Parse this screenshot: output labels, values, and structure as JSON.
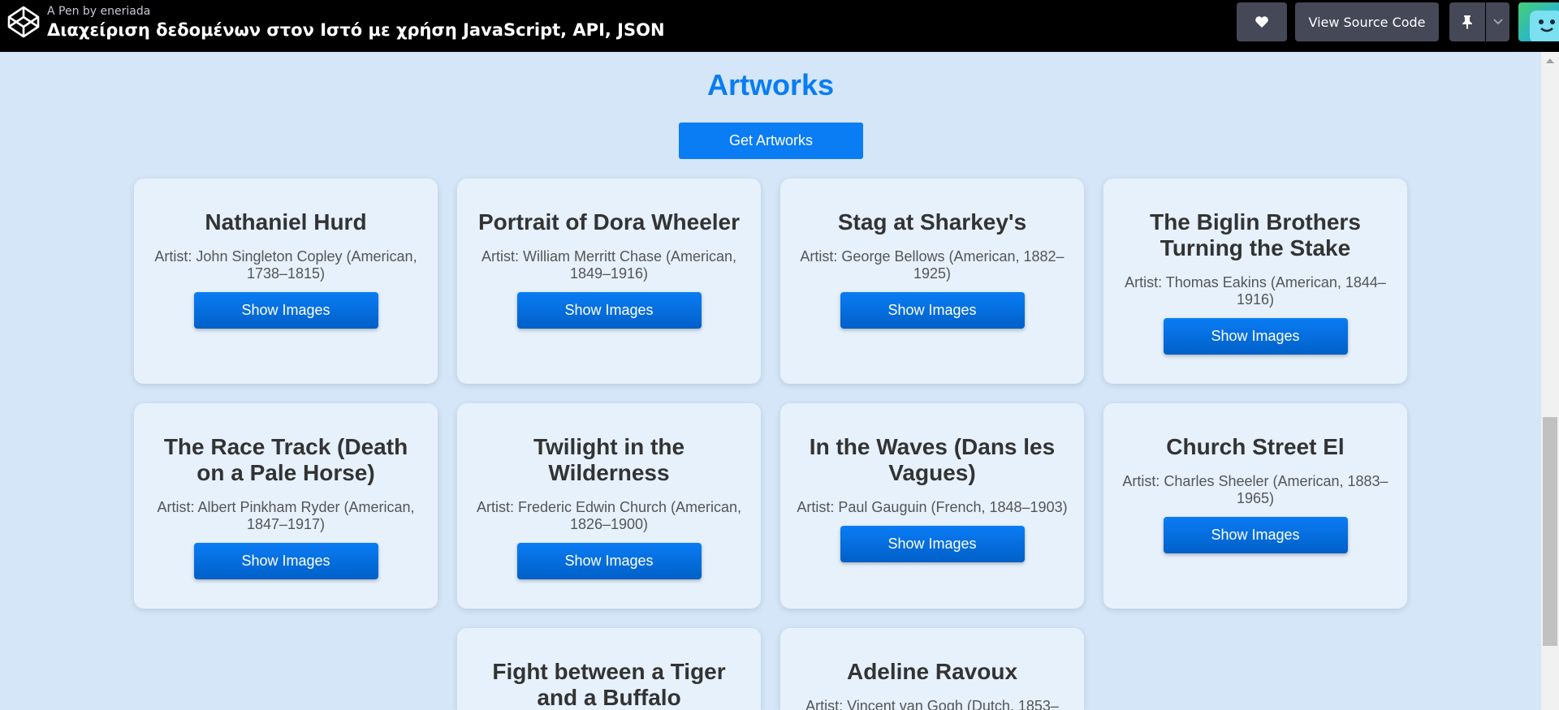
{
  "header": {
    "pen_by": "A Pen by eneriada",
    "pen_title": "Διαχείριση δεδομένων στον Ιστό με χρήση JavaScript, API, JSON",
    "view_source_label": "View Source Code",
    "heart_icon": "heart-icon",
    "pin_icon": "pin-icon"
  },
  "main": {
    "title": "Artworks",
    "get_button_label": "Get Artworks",
    "show_button_label": "Show Images",
    "artworks": [
      {
        "title": "Nathaniel Hurd",
        "artist": "Artist: John Singleton Copley (American, 1738–1815)"
      },
      {
        "title": "Portrait of Dora Wheeler",
        "artist": "Artist: William Merritt Chase (American, 1849–1916)"
      },
      {
        "title": "Stag at Sharkey's",
        "artist": "Artist: George Bellows (American, 1882–1925)"
      },
      {
        "title": "The Biglin Brothers Turning the Stake",
        "artist": "Artist: Thomas Eakins (American, 1844–1916)"
      },
      {
        "title": "The Race Track (Death on a Pale Horse)",
        "artist": "Artist: Albert Pinkham Ryder (American, 1847–1917)"
      },
      {
        "title": "Twilight in the Wilderness",
        "artist": "Artist: Frederic Edwin Church (American, 1826–1900)"
      },
      {
        "title": "In the Waves (Dans les Vagues)",
        "artist": "Artist: Paul Gauguin (French, 1848–1903)"
      },
      {
        "title": "Church Street El",
        "artist": "Artist: Charles Sheeler (American, 1883–1965)"
      },
      {
        "title": "Fight between a Tiger and a Buffalo",
        "artist": ""
      },
      {
        "title": "Adeline Ravoux",
        "artist": "Artist: Vincent van Gogh (Dutch, 1853–"
      }
    ]
  },
  "colors": {
    "accent": "#0a7cf4",
    "background": "#d4e6f8",
    "card": "#e6f1fc",
    "topbar": "#000000"
  }
}
